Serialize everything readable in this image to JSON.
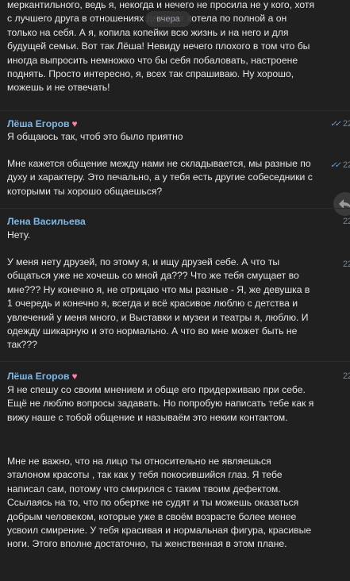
{
  "date_badge": "вчера",
  "messages": [
    {
      "sender": "",
      "text": "меркантильного, ведь я, некогда и нечего не просила не у кого, хотя с лучшего друга в отношениях деньжат хотела по полной а он только на себя. А я, копила копейки всю жизнь и на него и для будущей семьи. Вот так Лёша! Невиду нечего плохого в том что бы иногда выпросить немножко что бы себя побаловать, настроене поднять. Просто интересно, я, всех так спрашиваю. Ну хорошо, можешь и не отвечать!",
      "time": ""
    },
    {
      "sender": "Лёша Егоров",
      "heart": "♥",
      "text": "Я общаюсь так, чтоб это было приятно",
      "time": "22",
      "read": "✓✓"
    },
    {
      "sender": "",
      "text": "Мне кажется общение между нами не складывается, мы разные по духу и характеру. Это печально, а у тебя есть другие собеседники с которыми ты хорошо общаешься?",
      "time": "22",
      "read": "✓✓"
    },
    {
      "sender": "Лена Васильева",
      "text": "Нету.",
      "time": "22"
    },
    {
      "sender": "",
      "text": "У меня нету друзей, по этому я, и ищу друзей себе. А что ты общаться уже не хочешь со мной да??? Что же тебя смущает во мне??? Ну конечно я, не отрицаю что мы разные - Я, же девушка в 1 очередь и конечно я, всегда и всё красивое люблю с детства и увлечений у меня много, и Выставки и музеи и театры я, люблю. И одежду шикарную и это нормально. А что во мне может быть не так???",
      "time": "22"
    },
    {
      "sender": "Лёша Егоров",
      "heart": "♥",
      "text": "Я не спешу со своим мнением и обще его придерживаю при себе. Ещё не люблю вопросы задавать. Но попробую написать тебе как я вижу наше с тобой общение и называём это неким контактом.",
      "time": "22"
    },
    {
      "sender": "",
      "text": "Мне не важно, что на лицо ты относительно не являешься эталоном красоты , так как у тебя покосившийся глаз. Я тебе написал сам, потому что смирился с таким твоим дефектом. Ссылаясь на то, что по обертке не судят и ты можешь оказаться добрым человеком, которые уже в своём возрасте более менее усвоил смирение. У тебя красивая и нормальная фигура, красивые ноги. Этого вполне достаточно, ты женственная в этом плане.",
      "time": ""
    }
  ]
}
